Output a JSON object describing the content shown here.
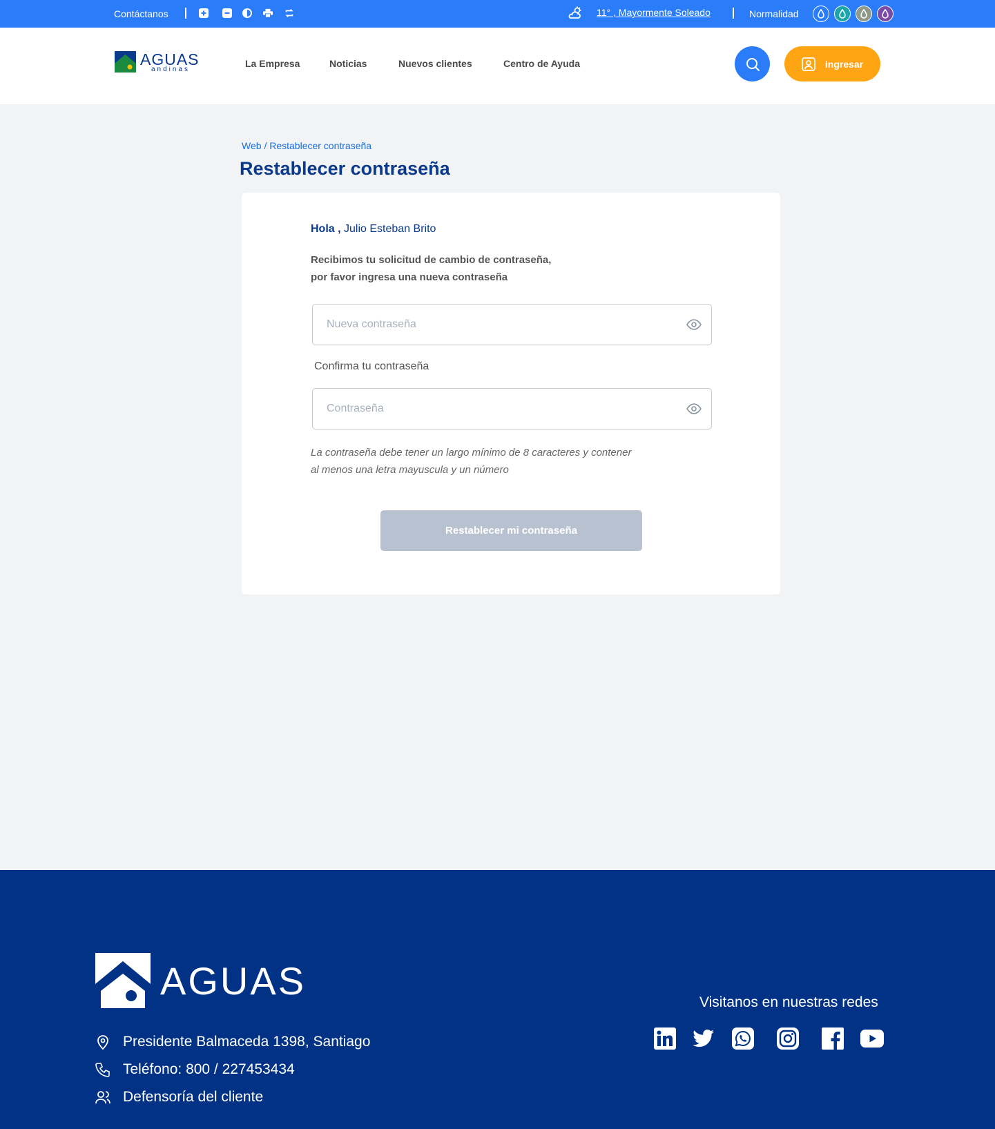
{
  "topbar": {
    "contact_label": "Contáctanos",
    "weather": "11° , Mayormente Soleado",
    "status": "Normalidad",
    "icons": [
      "zoom-in-icon",
      "zoom-out-icon",
      "contrast-icon",
      "print-icon",
      "refresh-icon"
    ],
    "drop_colors": [
      "#2a7cf8",
      "#1aa6a8",
      "#8f9a8a",
      "#7a4aa8"
    ]
  },
  "header": {
    "logo_text": "AGUAS",
    "logo_subtext": "andinas",
    "nav": [
      "La Empresa",
      "Noticias",
      "Nuevos clientes",
      "Centro de Ayuda"
    ],
    "login_label": "ingresar"
  },
  "breadcrumb": {
    "root": "Web",
    "separator": "/",
    "current": "Restablecer contraseña"
  },
  "page": {
    "title": "Restablecer contraseña",
    "greeting": "Hola ,",
    "user_name": "Julio Esteban Brito",
    "message_line1": "Recibimos tu solicitud de cambio de contraseña,",
    "message_line2": "por favor ingresa una nueva contraseña",
    "new_password_placeholder": "Nueva contraseña",
    "confirm_label": "Confirma tu contraseña",
    "confirm_placeholder": "Contraseña",
    "hint_line1": "La contraseña debe tener un largo mínimo de 8 caracteres y contener",
    "hint_line2": "al menos una letra mayuscula y un número",
    "submit_label": "Restablecer mi contraseña"
  },
  "footer": {
    "logo_text": "AGUAS",
    "address": "Presidente Balmaceda 1398, Santiago",
    "phone": "Teléfono: 800 / 227453434",
    "defensoria": "Defensoría del cliente",
    "redes_label": "Visitanos en nuestras redes",
    "social": [
      "linkedin",
      "twitter",
      "whatsapp",
      "instagram",
      "facebook",
      "youtube"
    ]
  },
  "colors": {
    "topbar": "#2a7cf8",
    "primary_dark": "#0a3a8c",
    "accent": "#ffa412",
    "footer": "#023286",
    "disabled_button": "#b8c1cf"
  }
}
